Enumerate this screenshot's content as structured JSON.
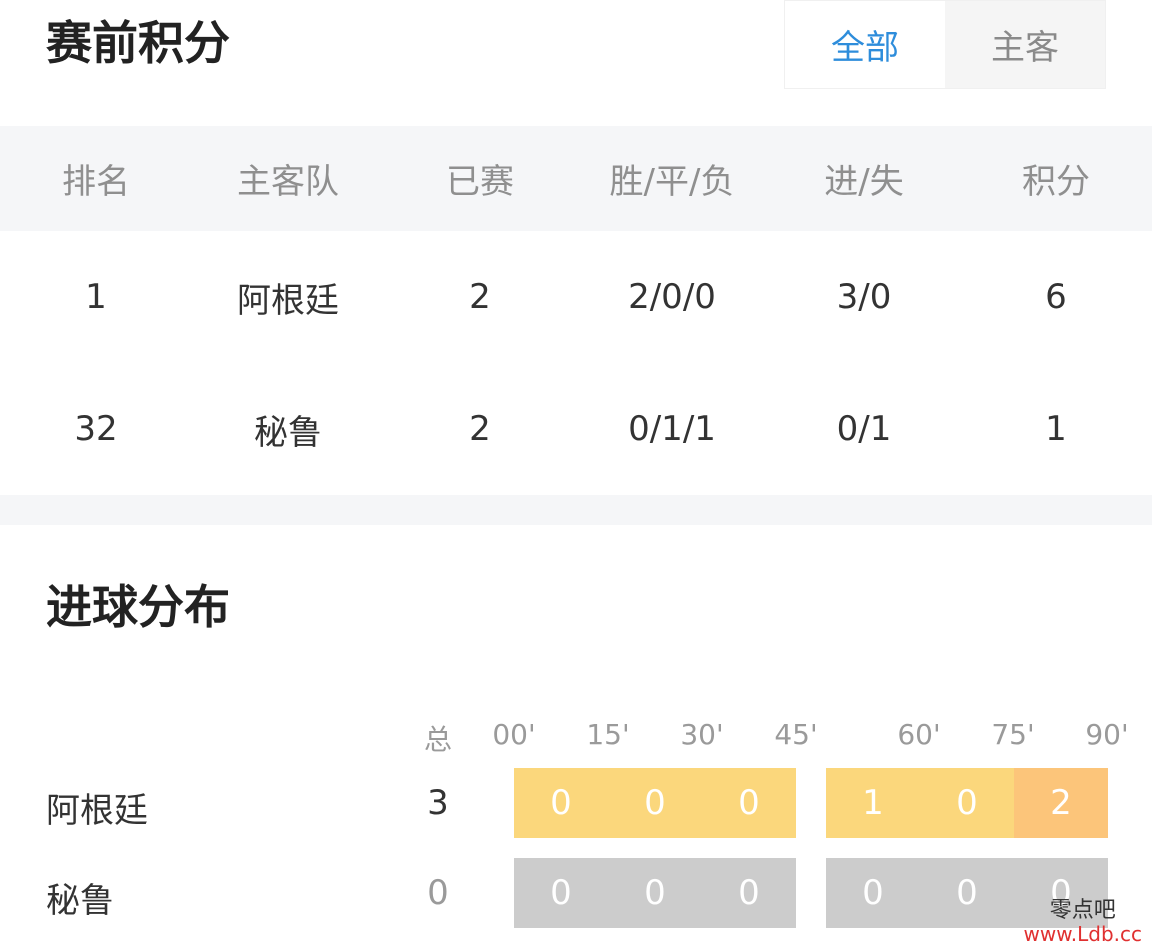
{
  "standings": {
    "title": "赛前积分",
    "tabs": [
      {
        "label": "全部",
        "active": true
      },
      {
        "label": "主客",
        "active": false
      }
    ],
    "columns": [
      "排名",
      "主客队",
      "已赛",
      "胜/平/负",
      "进/失",
      "积分"
    ],
    "rows": [
      [
        "1",
        "阿根廷",
        "2",
        "2/0/0",
        "3/0",
        "6"
      ],
      [
        "32",
        "秘鲁",
        "2",
        "0/1/1",
        "0/1",
        "1"
      ]
    ]
  },
  "goals": {
    "title": "进球分布",
    "total_label": "总",
    "time_labels": [
      "00'",
      "15'",
      "30'",
      "45'",
      "60'",
      "75'",
      "90'"
    ],
    "teams": [
      {
        "name": "阿根廷",
        "total": "3",
        "first_half": [
          "0",
          "0",
          "0"
        ],
        "second_half": [
          "1",
          "0",
          "2"
        ]
      },
      {
        "name": "秘鲁",
        "total": "0",
        "first_half": [
          "0",
          "0",
          "0"
        ],
        "second_half": [
          "0",
          "0",
          "0"
        ]
      }
    ],
    "colors": {
      "highlight": "#fbd77c",
      "max": "#fcc57a",
      "empty": "#cccccc",
      "total_nonzero": "#333333",
      "total_zero": "#9a9a9a"
    }
  },
  "theme": {
    "accent": "#2e8ddb",
    "header_bg": "#f5f6f8"
  },
  "watermark": {
    "text": "零点吧",
    "url": "www.Ldb.cc"
  }
}
